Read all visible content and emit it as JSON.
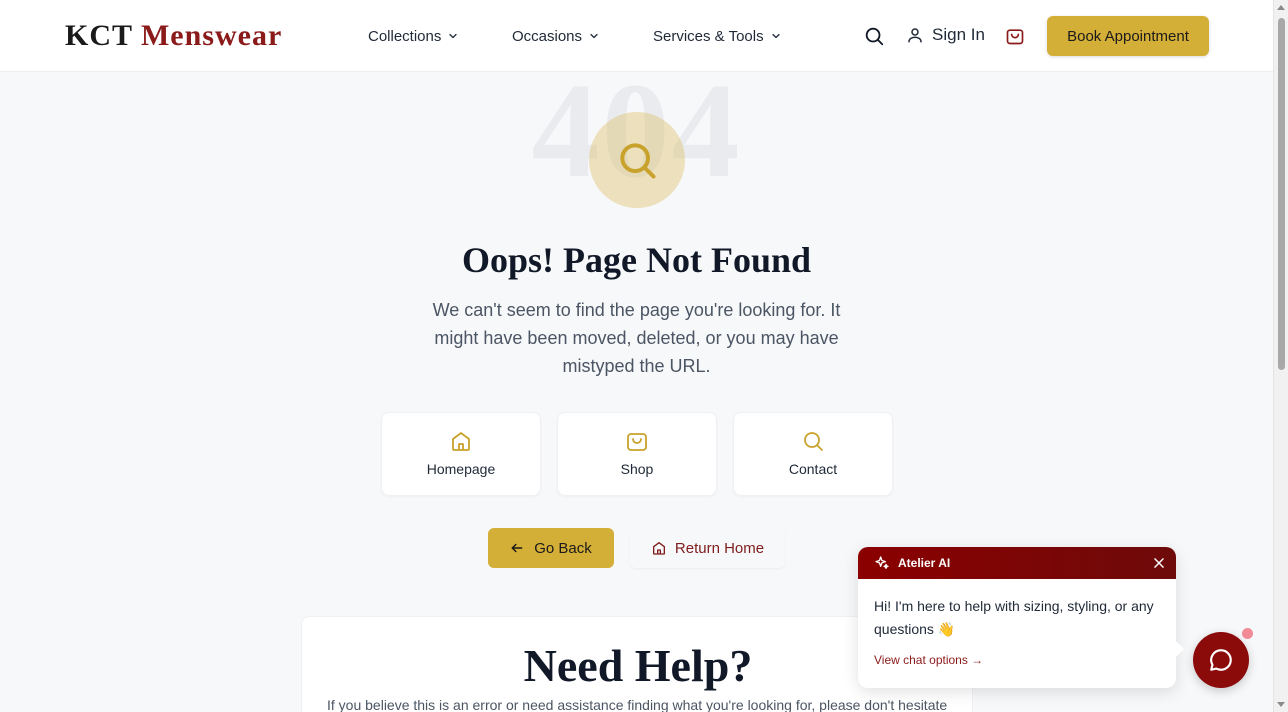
{
  "header": {
    "logo_part1": "KCT",
    "logo_part2": "Menswear",
    "nav": [
      {
        "label": "Collections"
      },
      {
        "label": "Occasions"
      },
      {
        "label": "Services & Tools"
      }
    ],
    "sign_in": "Sign In",
    "book_appointment": "Book Appointment",
    "icons": [
      "search-icon",
      "user-icon",
      "shopping-bag-icon"
    ]
  },
  "error": {
    "code": "404",
    "title": "Oops! Page Not Found",
    "description": "We can't seem to find the page you're looking for. It might have been moved, deleted, or you may have mistyped the URL."
  },
  "quick_links": [
    {
      "label": "Homepage",
      "icon": "home-icon"
    },
    {
      "label": "Shop",
      "icon": "shopping-bag-icon"
    },
    {
      "label": "Contact",
      "icon": "search-icon"
    }
  ],
  "actions": {
    "go_back": "Go Back",
    "return_home": "Return Home"
  },
  "help": {
    "title": "Need Help?",
    "text": "If you believe this is an error or need assistance finding what you're looking for, please don't hesitate"
  },
  "chat": {
    "title": "Atelier AI",
    "message": "Hi! I'm here to help with sizing, styling, or any questions 👋",
    "link": "View chat options →"
  },
  "colors": {
    "accent_gold": "#d4af37",
    "brand_burgundy": "#8b1a1a",
    "background": "#f7f8fa"
  }
}
